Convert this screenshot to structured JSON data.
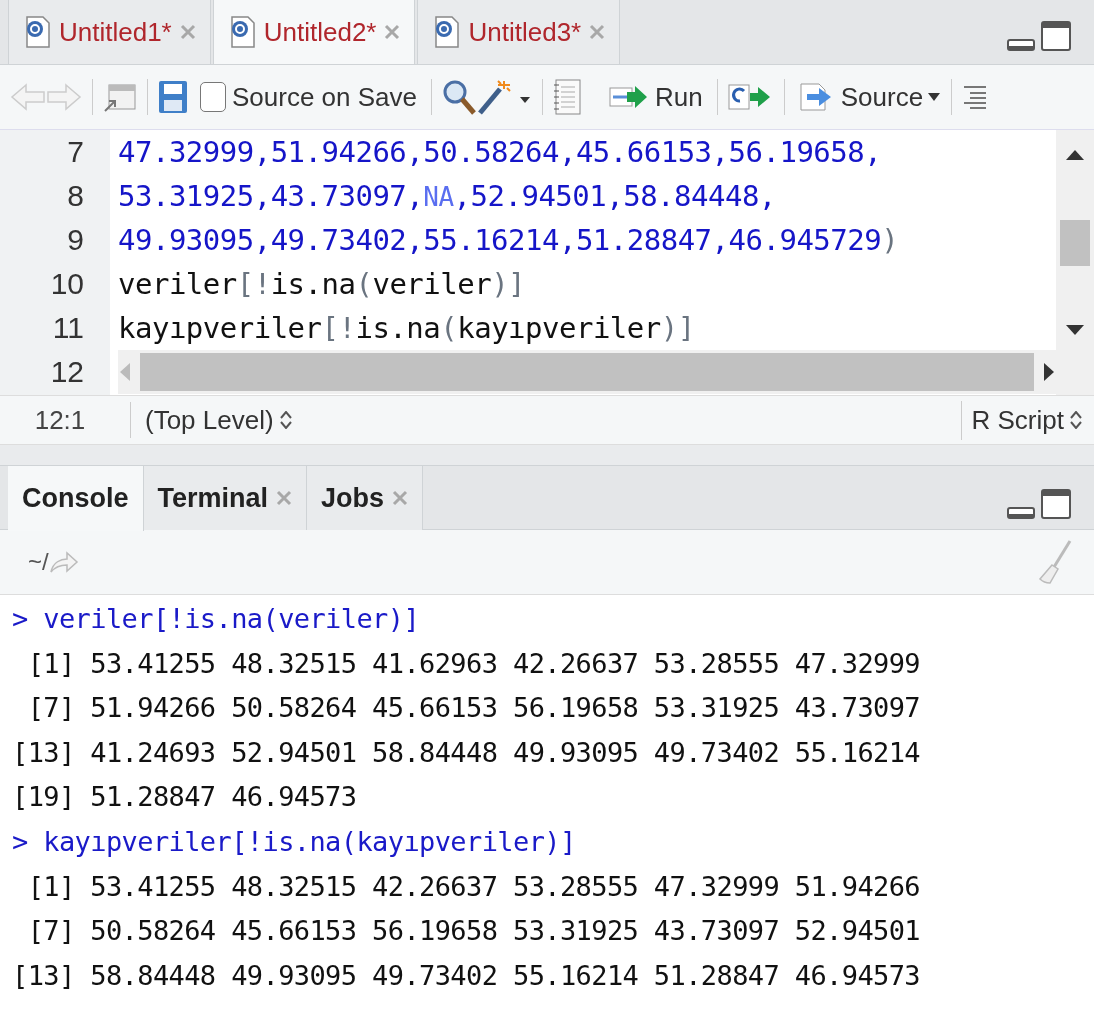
{
  "editor_tabs": [
    {
      "label": "Untitled1*",
      "selected": false
    },
    {
      "label": "Untitled2*",
      "selected": true
    },
    {
      "label": "Untitled3*",
      "selected": false
    }
  ],
  "toolbar": {
    "source_on_save": {
      "label": "Source on Save",
      "checked": false
    },
    "run": "Run",
    "source": "Source"
  },
  "editor": {
    "lines": [
      {
        "number": "7",
        "tokens": [
          {
            "kind": "number",
            "text": "47.32999,51.94266,50.58264,45.66153,56.19658,"
          }
        ]
      },
      {
        "number": "8",
        "tokens": [
          {
            "kind": "number",
            "text": "53.31925,43.73097,"
          },
          {
            "kind": "na",
            "text": "NA"
          },
          {
            "kind": "number",
            "text": ",52.94501,58.84448,"
          }
        ]
      },
      {
        "number": "9",
        "tokens": [
          {
            "kind": "number",
            "text": "49.93095,49.73402,55.16214,51.28847,46.945729"
          },
          {
            "kind": "punct",
            "text": ")"
          }
        ]
      },
      {
        "number": "10",
        "tokens": [
          {
            "kind": "plain",
            "text": "veriler"
          },
          {
            "kind": "punct",
            "text": "[!"
          },
          {
            "kind": "plain",
            "text": "is.na"
          },
          {
            "kind": "punct",
            "text": "("
          },
          {
            "kind": "plain",
            "text": "veriler"
          },
          {
            "kind": "punct",
            "text": ")]"
          }
        ]
      },
      {
        "number": "11",
        "tokens": [
          {
            "kind": "plain",
            "text": "kayıpveriler"
          },
          {
            "kind": "punct",
            "text": "[!"
          },
          {
            "kind": "plain",
            "text": "is.na"
          },
          {
            "kind": "punct",
            "text": "("
          },
          {
            "kind": "plain",
            "text": "kayıpveriler"
          },
          {
            "kind": "punct",
            "text": ")]"
          }
        ]
      },
      {
        "number": "12"
      }
    ]
  },
  "status_bar": {
    "position": "12:1",
    "scope": "(Top Level)",
    "file_type": "R Script"
  },
  "console_tabs": [
    {
      "label": "Console",
      "selected": true,
      "closable": false
    },
    {
      "label": "Terminal",
      "selected": false,
      "closable": true
    },
    {
      "label": "Jobs",
      "selected": false,
      "closable": true
    }
  ],
  "console": {
    "path": "~/",
    "lines": [
      {
        "kind": "input",
        "prompt": ">",
        "text": "veriler[!is.na(veriler)]"
      },
      {
        "kind": "output",
        "text": " [1] 53.41255 48.32515 41.62963 42.26637 53.28555 47.32999"
      },
      {
        "kind": "output",
        "text": " [7] 51.94266 50.58264 45.66153 56.19658 53.31925 43.73097"
      },
      {
        "kind": "output",
        "text": "[13] 41.24693 52.94501 58.84448 49.93095 49.73402 55.16214"
      },
      {
        "kind": "output",
        "text": "[19] 51.28847 46.94573"
      },
      {
        "kind": "input",
        "prompt": ">",
        "text": "kayıpveriler[!is.na(kayıpveriler)]"
      },
      {
        "kind": "output",
        "text": " [1] 53.41255 48.32515 42.26637 53.28555 47.32999 51.94266"
      },
      {
        "kind": "output",
        "text": " [7] 50.58264 45.66153 56.19658 53.31925 43.73097 52.94501"
      },
      {
        "kind": "output",
        "text": "[13] 58.84448 49.93095 49.73402 55.16214 51.28847 46.94573"
      }
    ]
  }
}
